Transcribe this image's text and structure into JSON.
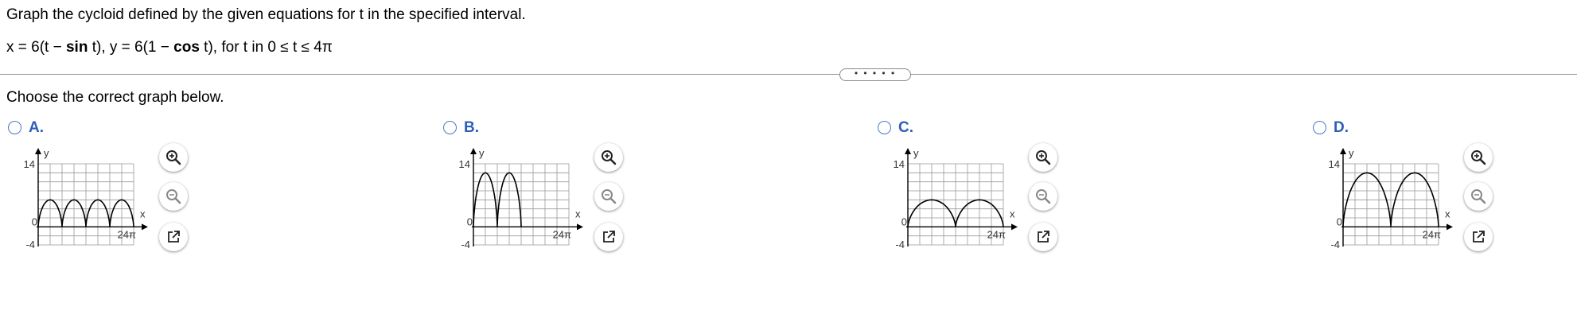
{
  "question": {
    "title": "Graph the cycloid defined by the given equations for t in the specified interval.",
    "eq_x_part": "x = 6(t − ",
    "eq_sin": "sin",
    "eq_mid": " t), y = 6(1 − ",
    "eq_cos": "cos",
    "eq_end": " t), for t in 0 ≤ t ≤ 4π"
  },
  "divider_handle": "• • • • •",
  "prompt": "Choose the correct graph below.",
  "choices": [
    {
      "letter": "A.",
      "arches": 4,
      "arch_height": 6
    },
    {
      "letter": "B.",
      "arches": 2,
      "arch_height": 12,
      "arch_span_ratio": 0.5
    },
    {
      "letter": "C.",
      "arches": 2,
      "arch_height": 6
    },
    {
      "letter": "D.",
      "arches": 2,
      "arch_height": 12
    }
  ],
  "graph_labels": {
    "y": "y",
    "x": "x",
    "y_max": "14",
    "y_min": "-4",
    "origin": "0",
    "x_max": "24π"
  },
  "axis_ranges": {
    "x": [
      0,
      24
    ],
    "y": [
      -4,
      14
    ]
  },
  "icons": [
    "zoom-in-icon",
    "zoom-out-icon",
    "open-new-window-icon"
  ],
  "accent_color": "#2e5eb8"
}
